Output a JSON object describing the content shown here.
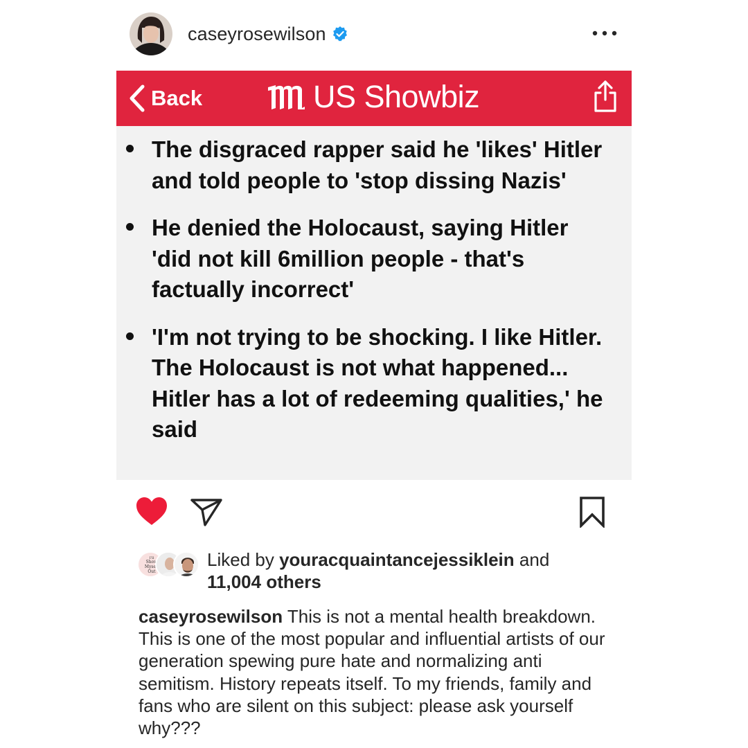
{
  "post": {
    "username": "caseyrosewilson",
    "verified": true,
    "more_icon": "more-horizontal-icon"
  },
  "article": {
    "topbar_color": "#e0243e",
    "back_label": "Back",
    "section_title": "US Showbiz",
    "share_icon": "share-icon",
    "bullets": [
      "The disgraced rapper said he 'likes' Hitler and told people to 'stop dissing Nazis'",
      "He denied the Holocaust, saying Hitler 'did not kill 6million people - that's factually incorrect'",
      "'I'm not trying to be shocking. I like Hitler. The Holocaust is not what happened... Hitler has a lot of redeeming qualities,' he said"
    ]
  },
  "actions": {
    "like_icon": "heart-filled-icon",
    "like_color": "#ed1c39",
    "share_icon": "paper-plane-icon",
    "save_icon": "bookmark-icon"
  },
  "likes": {
    "prefix": "Liked by ",
    "user": "youracquaintancejessiklein",
    "middle": " and",
    "count": "11,004 others",
    "avatar_text": [
      "I'll",
      "Show",
      "Myself",
      "Out"
    ]
  },
  "caption": {
    "username": "caseyrosewilson",
    "text": " This is not a mental health breakdown. This is one of the most popular and influential artists of our generation spewing pure hate and normalizing anti semitism. History repeats itself. To my friends, family and fans who are silent on this subject: please ask yourself why???"
  }
}
